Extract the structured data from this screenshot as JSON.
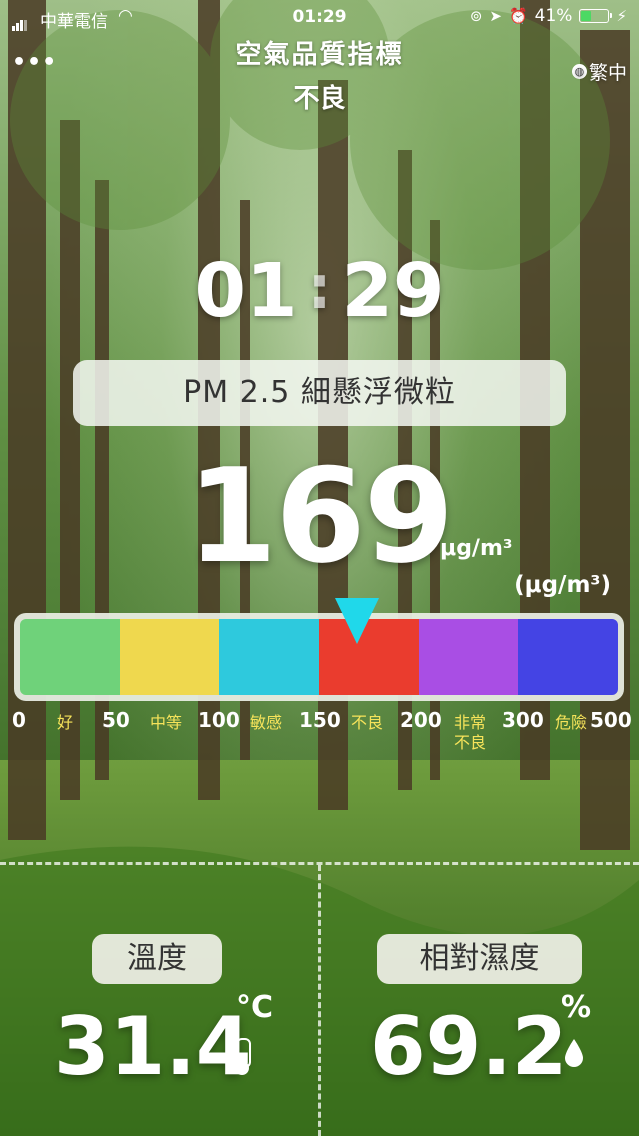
{
  "status_bar": {
    "carrier": "中華電信",
    "time": "01:29",
    "battery": "41%",
    "battery_level": 0.41
  },
  "header": {
    "menu": "•••",
    "title": "空氣品質指標",
    "subtitle": "不良",
    "language": "繁中"
  },
  "clock": {
    "hours": "01",
    "minutes": "29"
  },
  "pm": {
    "label": "PM 2.5 細懸浮微粒",
    "value": "169",
    "unit_inline": "μg/m³",
    "unit_right": "(μg/m³)"
  },
  "scale": {
    "ticks": [
      "0",
      "50",
      "100",
      "150",
      "200",
      "300",
      "500"
    ],
    "categories": [
      "好",
      "中等",
      "敏感",
      "不良",
      "非常\n不良",
      "危險"
    ],
    "colors": [
      "#6fd27a",
      "#efd84e",
      "#2ec9dd",
      "#ea3c2e",
      "#a94ee4",
      "#4444e4"
    ],
    "pointer_value": 169
  },
  "temperature": {
    "label": "溫度",
    "value": "31.4",
    "unit": "°C"
  },
  "humidity": {
    "label": "相對濕度",
    "value": "69.2",
    "unit": "%"
  }
}
